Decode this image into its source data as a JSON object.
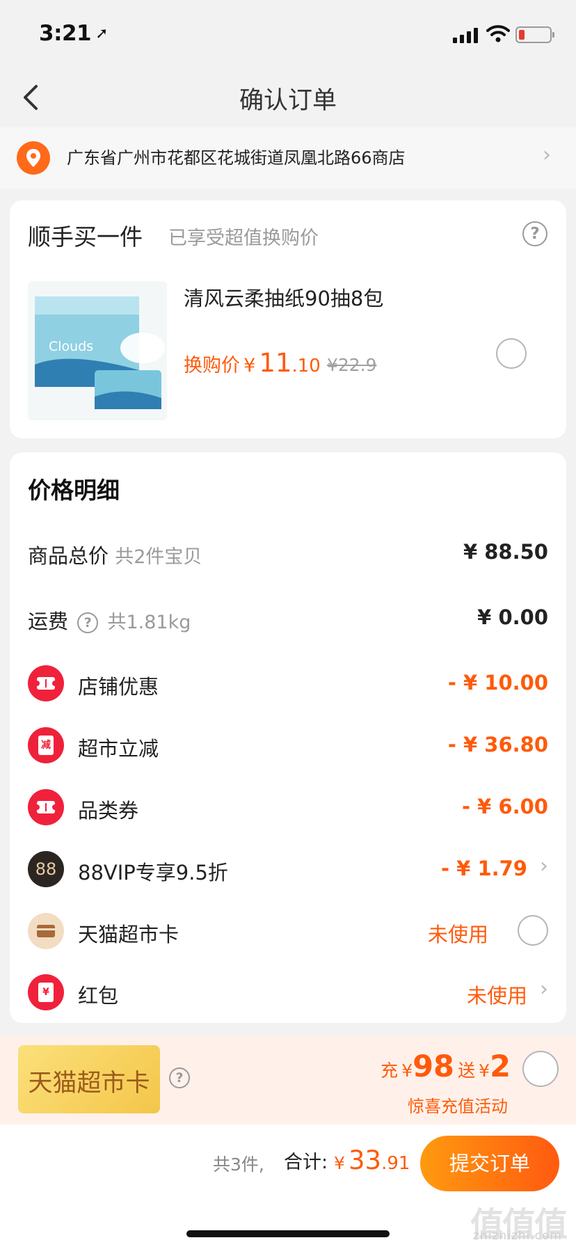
{
  "status_bar": {
    "time": "3:21"
  },
  "nav": {
    "title": "确认订单"
  },
  "address": {
    "text": "广东省广州市花都区花城街道凤凰北路66商店"
  },
  "addon": {
    "title": "顺手买一件",
    "subtitle": "已享受超值换购价",
    "product": {
      "name": "清风云柔抽纸90抽8包",
      "price_label": "换购价",
      "currency": "¥",
      "price_int": "11",
      "price_dec": ".10",
      "original_price": "¥22.9",
      "image_text": "Clouds"
    }
  },
  "price_detail": {
    "heading": "价格明细",
    "goods": {
      "label": "商品总价",
      "sub": "共2件宝贝",
      "value": "¥ 88.50"
    },
    "shipping": {
      "label": "运费",
      "sub": "共1.81kg",
      "value": "¥ 0.00"
    },
    "discounts": [
      {
        "label": "店铺优惠",
        "value": "- ¥ 10.00",
        "icon": "coupon-ticket-icon"
      },
      {
        "label": "超市立减",
        "value": "- ¥ 36.80",
        "icon": "reduce-icon",
        "badge_text": "减"
      },
      {
        "label": "品类券",
        "value": "- ¥ 6.00",
        "icon": "coupon-ticket-icon"
      },
      {
        "label": "88VIP专享9.5折",
        "value": "- ¥ 1.79",
        "icon": "88vip-icon",
        "badge_text": "88"
      },
      {
        "label": "天猫超市卡",
        "value": "未使用",
        "icon": "card-icon"
      },
      {
        "label": "红包",
        "value": "未使用",
        "icon": "red-envelope-icon",
        "badge_text": "¥"
      }
    ]
  },
  "promo": {
    "card_text": "天猫超市卡",
    "charge_word": "充",
    "charge_amount": "98",
    "gift_word": "送",
    "gift_amount": "2",
    "currency": "¥",
    "note": "惊喜充值活动"
  },
  "footer": {
    "count": "共3件,",
    "total_label": "合计:",
    "currency": "¥",
    "amount_int": "33",
    "amount_dec": ".91",
    "submit_label": "提交订单"
  },
  "watermark": {
    "logo": "值值值",
    "site": "zhizhizhi.com"
  },
  "colors": {
    "accent": "#ff5a0a",
    "red_badge": "#f0213b",
    "location": "#ff6a1a"
  }
}
